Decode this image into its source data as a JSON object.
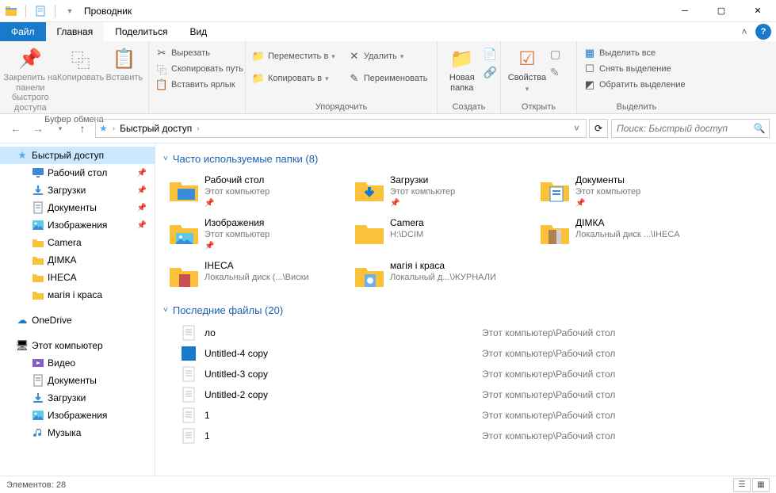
{
  "window": {
    "title": "Проводник"
  },
  "tabs": {
    "file": "Файл",
    "home": "Главная",
    "share": "Поделиться",
    "view": "Вид"
  },
  "ribbon": {
    "clipboard": {
      "pin": "Закрепить на панели\nбыстрого доступа",
      "copy": "Копировать",
      "paste": "Вставить",
      "cut": "Вырезать",
      "copypath": "Скопировать путь",
      "pasteshortcut": "Вставить ярлык",
      "label": "Буфер обмена"
    },
    "organize": {
      "moveto": "Переместить в",
      "copyto": "Копировать в",
      "delete": "Удалить",
      "rename": "Переименовать",
      "label": "Упорядочить"
    },
    "new": {
      "newfolder": "Новая\nпапка",
      "label": "Создать"
    },
    "open": {
      "properties": "Свойства",
      "label": "Открыть"
    },
    "select": {
      "selectall": "Выделить все",
      "selectnone": "Снять выделение",
      "invert": "Обратить выделение",
      "label": "Выделить"
    }
  },
  "breadcrumb": {
    "root": "Быстрый доступ"
  },
  "search": {
    "placeholder": "Поиск: Быстрый доступ"
  },
  "sidebar": {
    "quick": "Быстрый доступ",
    "items": [
      {
        "label": "Рабочий стол",
        "icon": "desktop",
        "pinned": true
      },
      {
        "label": "Загрузки",
        "icon": "downloads",
        "pinned": true
      },
      {
        "label": "Документы",
        "icon": "documents",
        "pinned": true
      },
      {
        "label": "Изображения",
        "icon": "pictures",
        "pinned": true
      },
      {
        "label": "Camera",
        "icon": "folder",
        "pinned": false
      },
      {
        "label": "ДІМКА",
        "icon": "folder",
        "pinned": false
      },
      {
        "label": "IHECA",
        "icon": "folder",
        "pinned": false
      },
      {
        "label": "магія і краса",
        "icon": "folder",
        "pinned": false
      }
    ],
    "onedrive": "OneDrive",
    "thispc": "Этот компьютер",
    "pcitems": [
      {
        "label": "Видео",
        "icon": "videos"
      },
      {
        "label": "Документы",
        "icon": "documents"
      },
      {
        "label": "Загрузки",
        "icon": "downloads"
      },
      {
        "label": "Изображения",
        "icon": "pictures"
      },
      {
        "label": "Музыка",
        "icon": "music"
      }
    ]
  },
  "content": {
    "freq_label": "Часто используемые папки (8)",
    "freq": [
      {
        "name": "Рабочий стол",
        "loc": "Этот компьютер",
        "icon": "desktop",
        "pinned": true
      },
      {
        "name": "Загрузки",
        "loc": "Этот компьютер",
        "icon": "downloads",
        "pinned": true
      },
      {
        "name": "Документы",
        "loc": "Этот компьютер",
        "icon": "documents",
        "pinned": true
      },
      {
        "name": "Изображения",
        "loc": "Этот компьютер",
        "icon": "pictures",
        "pinned": true
      },
      {
        "name": "Camera",
        "loc": "H:\\DCIM",
        "icon": "folder",
        "pinned": false
      },
      {
        "name": "ДІМКА",
        "loc": "Локальный диск ...\\IHECA",
        "icon": "thumb",
        "pinned": false
      },
      {
        "name": "IHECA",
        "loc": "Локальный диск (...\\Виски",
        "icon": "thumb2",
        "pinned": false
      },
      {
        "name": "магія і краса",
        "loc": "Локальный д...\\ЖУРНАЛИ",
        "icon": "thumb3",
        "pinned": false
      }
    ],
    "recent_label": "Последние файлы (20)",
    "recent": [
      {
        "name": "ло",
        "loc": "Этот компьютер\\Рабочий стол",
        "icon": "txt"
      },
      {
        "name": "Untitled-4 copy",
        "loc": "Этот компьютер\\Рабочий стол",
        "icon": "img"
      },
      {
        "name": "Untitled-3 copy",
        "loc": "Этот компьютер\\Рабочий стол",
        "icon": "txt"
      },
      {
        "name": "Untitled-2 copy",
        "loc": "Этот компьютер\\Рабочий стол",
        "icon": "txt"
      },
      {
        "name": "1",
        "loc": "Этот компьютер\\Рабочий стол",
        "icon": "txt"
      },
      {
        "name": "1",
        "loc": "Этот компьютер\\Рабочий стол",
        "icon": "txt"
      }
    ]
  },
  "status": {
    "items": "Элементов: 28"
  }
}
